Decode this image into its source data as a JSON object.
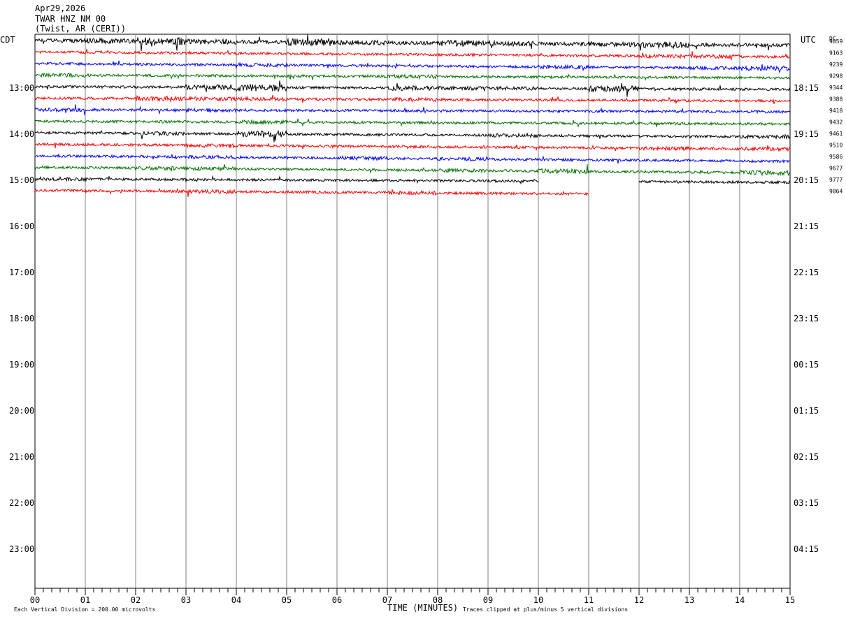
{
  "header": {
    "date": "Apr29,2026",
    "station": "TWAR HNZ NM 00",
    "location": "(Twist, AR (CERI))"
  },
  "axes": {
    "left_title": "CDT",
    "right_title": "UTC",
    "dc_title": "DC",
    "x_label": "TIME (MINUTES)",
    "x_ticks": [
      "00",
      "01",
      "02",
      "03",
      "04",
      "05",
      "06",
      "07",
      "08",
      "09",
      "10",
      "11",
      "12",
      "13",
      "14",
      "15"
    ],
    "left_hours": [
      "13:00",
      "14:00",
      "15:00",
      "16:00",
      "17:00",
      "18:00",
      "19:00",
      "20:00",
      "21:00",
      "22:00",
      "23:00"
    ],
    "right_hours": [
      "18:15",
      "19:15",
      "20:15",
      "21:15",
      "22:15",
      "23:15",
      "00:15",
      "01:15",
      "02:15",
      "03:15",
      "04:15"
    ]
  },
  "footer": {
    "scale_note": "Each Vertical Division =  200.00 microvolts",
    "clip_note": "Traces clipped at plus/minus 5 vertical divisions"
  },
  "chart_data": {
    "type": "line",
    "title": "TWAR HNZ NM 00",
    "xlabel": "TIME (MINUTES)",
    "xlim": [
      0,
      15
    ],
    "y_unit": "lines (15 minutes each), starting 12:00 CDT",
    "colors": [
      "#000000",
      "#ff0000",
      "#0000ff",
      "#007000"
    ],
    "grid": true,
    "lines": [
      {
        "dc": "9059",
        "color": "#000000",
        "end_minute": 15,
        "activity": [
          3,
          4,
          6,
          4,
          3,
          6,
          4,
          3,
          5,
          4,
          3,
          4,
          5,
          3,
          3
        ],
        "drift": 7
      },
      {
        "dc": "9163",
        "color": "#ff0000",
        "end_minute": 15,
        "activity": [
          2,
          2,
          2,
          2,
          2,
          2,
          2,
          2,
          2,
          2,
          2,
          2,
          3,
          3,
          2
        ],
        "drift": 7
      },
      {
        "dc": "9239",
        "color": "#0000ff",
        "end_minute": 15,
        "activity": [
          2,
          2,
          2,
          2,
          3,
          2,
          2,
          2,
          2,
          2,
          3,
          2,
          2,
          3,
          4
        ],
        "drift": 7
      },
      {
        "dc": "9298",
        "color": "#007000",
        "end_minute": 15,
        "activity": [
          3,
          2,
          2,
          2,
          2,
          2,
          2,
          3,
          2,
          2,
          2,
          2,
          2,
          2,
          2
        ],
        "drift": 4
      },
      {
        "dc": "9344",
        "color": "#000000",
        "end_minute": 15,
        "activity": [
          2,
          2,
          2,
          4,
          6,
          2,
          2,
          4,
          3,
          3,
          2,
          5,
          2,
          2,
          2
        ],
        "drift": 4
      },
      {
        "dc": "9388",
        "color": "#ff0000",
        "end_minute": 15,
        "activity": [
          2,
          2,
          4,
          3,
          3,
          2,
          2,
          3,
          2,
          2,
          2,
          2,
          2,
          2,
          2
        ],
        "drift": 4
      },
      {
        "dc": "9418",
        "color": "#0000ff",
        "end_minute": 15,
        "activity": [
          3,
          2,
          2,
          3,
          2,
          2,
          2,
          2,
          2,
          2,
          2,
          2,
          2,
          2,
          2
        ],
        "drift": 3
      },
      {
        "dc": "9432",
        "color": "#007000",
        "end_minute": 15,
        "activity": [
          2,
          2,
          2,
          2,
          3,
          2,
          2,
          2,
          2,
          2,
          2,
          2,
          2,
          2,
          2
        ],
        "drift": 4
      },
      {
        "dc": "9461",
        "color": "#000000",
        "end_minute": 15,
        "activity": [
          2,
          2,
          3,
          2,
          5,
          2,
          2,
          2,
          2,
          3,
          2,
          2,
          2,
          2,
          3
        ],
        "drift": 6
      },
      {
        "dc": "9510",
        "color": "#ff0000",
        "end_minute": 15,
        "activity": [
          2,
          2,
          2,
          3,
          2,
          2,
          2,
          2,
          2,
          2,
          2,
          2,
          3,
          2,
          3
        ],
        "drift": 7
      },
      {
        "dc": "9586",
        "color": "#0000ff",
        "end_minute": 15,
        "activity": [
          2,
          2,
          2,
          3,
          2,
          2,
          3,
          2,
          3,
          2,
          2,
          2,
          2,
          2,
          2
        ],
        "drift": 8
      },
      {
        "dc": "9677",
        "color": "#007000",
        "end_minute": 15,
        "activity": [
          2,
          2,
          3,
          3,
          2,
          2,
          2,
          2,
          3,
          2,
          4,
          2,
          2,
          2,
          4
        ],
        "drift": 8
      },
      {
        "dc": "9777",
        "color": "#000000",
        "end_minute": 10,
        "resume_minute": 12,
        "activity": [
          3,
          2,
          2,
          2,
          2,
          2,
          2,
          2,
          2,
          2,
          0,
          0,
          2,
          2,
          2
        ],
        "drift": 5
      },
      {
        "dc": "9864",
        "color": "#ff0000",
        "end_minute": 11,
        "activity": [
          2,
          2,
          2,
          3,
          2,
          2,
          2,
          3,
          2,
          2,
          2,
          0,
          0,
          0,
          0
        ],
        "drift": 7
      }
    ]
  }
}
